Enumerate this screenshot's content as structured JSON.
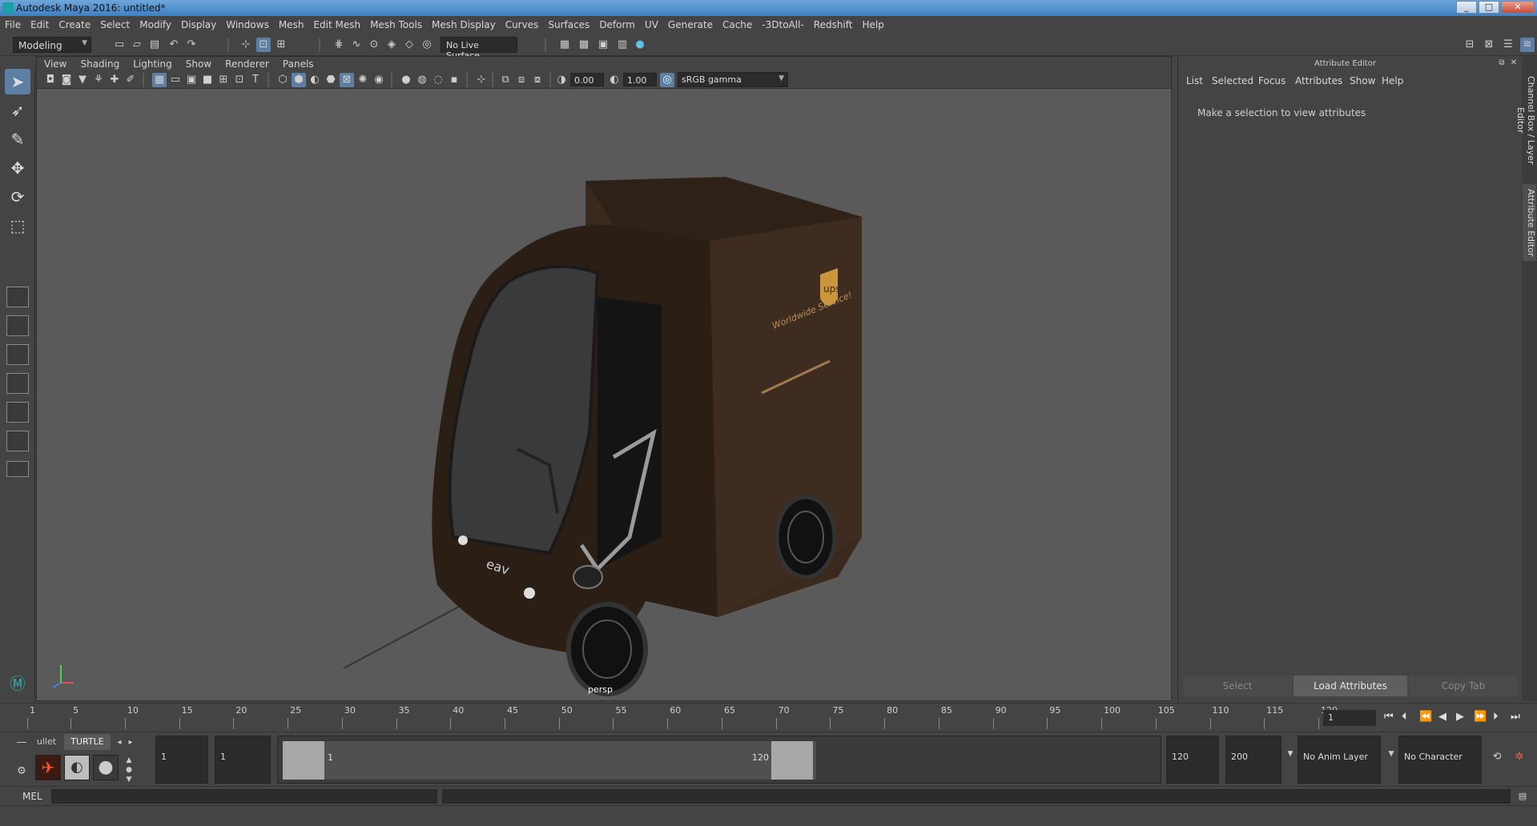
{
  "titlebar": {
    "title": "Autodesk Maya 2016: untitled*",
    "minimize": "_",
    "maximize": "□",
    "close": "✕"
  },
  "menubar": {
    "items": [
      "File",
      "Edit",
      "Create",
      "Select",
      "Modify",
      "Display",
      "Windows",
      "Mesh",
      "Edit Mesh",
      "Mesh Tools",
      "Mesh Display",
      "Curves",
      "Surfaces",
      "Deform",
      "UV",
      "Generate",
      "Cache",
      "-3DtoAll-",
      "Redshift",
      "Help"
    ]
  },
  "statusline": {
    "mode": "Modeling",
    "live_surface": "No Live Surface"
  },
  "viewport": {
    "menu": [
      "View",
      "Shading",
      "Lighting",
      "Show",
      "Renderer",
      "Panels"
    ],
    "exposure": "0.00",
    "gamma": "1.00",
    "color_space": "sRGB gamma",
    "camera": "persp",
    "model_text": {
      "logo": "ups",
      "slogan": "Worldwide Service!",
      "brand": "eav"
    }
  },
  "attribute_editor": {
    "title": "Attribute Editor",
    "menu": [
      "List",
      "Selected",
      "Focus",
      "Attributes",
      "Show",
      "Help"
    ],
    "message": "Make a selection to view attributes",
    "buttons": [
      "Select",
      "Load Attributes",
      "Copy Tab"
    ]
  },
  "side_tabs": {
    "channel_box": "Channel Box / Layer Editor",
    "attribute_editor": "Attribute Editor"
  },
  "timeslider": {
    "ticks": [
      "1",
      "5",
      "10",
      "15",
      "20",
      "25",
      "30",
      "35",
      "40",
      "45",
      "50",
      "55",
      "60",
      "65",
      "70",
      "75",
      "80",
      "85",
      "90",
      "95",
      "100",
      "105",
      "110",
      "115",
      "120"
    ],
    "current_frame": "1"
  },
  "range": {
    "shelf_tabs": [
      "ullet",
      "TURTLE"
    ],
    "start_a": "1",
    "start_b": "1",
    "range_start": "1",
    "range_end": "120",
    "end_a": "120",
    "end_b": "200",
    "anim_layer": "No Anim Layer",
    "character_set": "No Character Set"
  },
  "cmdline": {
    "label": "MEL"
  },
  "colors": {
    "accent": "#5d7fa3",
    "panel": "#444444",
    "viewport_bg": "#5a5a5a",
    "field": "#2b2b2b"
  }
}
